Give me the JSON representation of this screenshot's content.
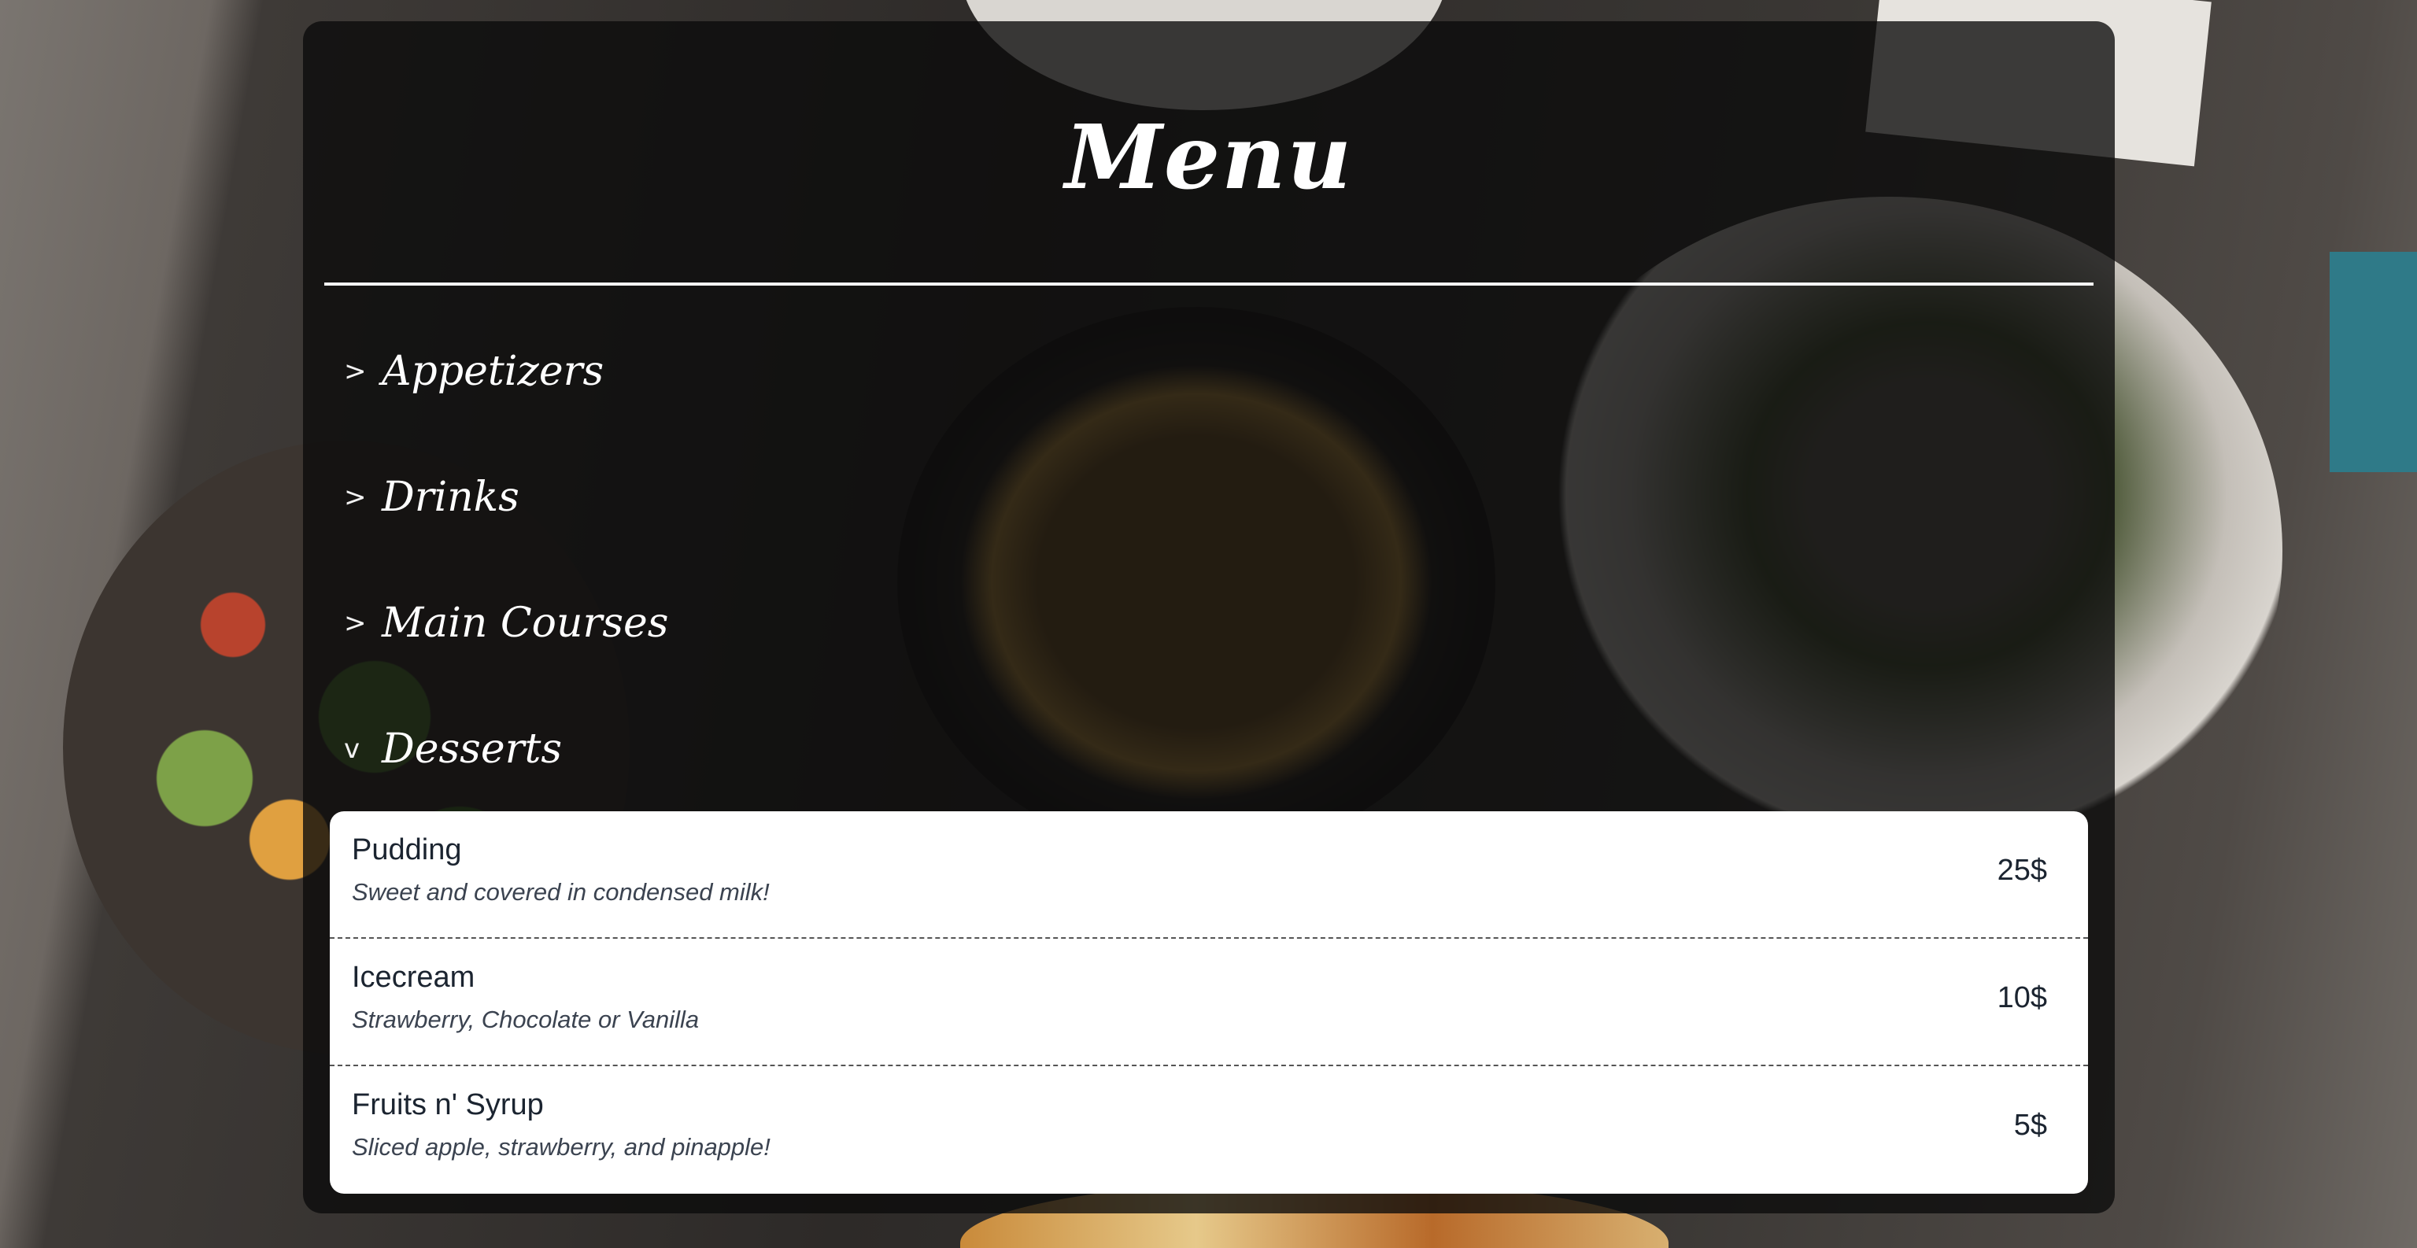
{
  "menu": {
    "title": "Menu",
    "categories": [
      {
        "label": "Appetizers",
        "chevron": ">",
        "expanded": false
      },
      {
        "label": "Drinks",
        "chevron": ">",
        "expanded": false
      },
      {
        "label": "Main Courses",
        "chevron": ">",
        "expanded": false
      },
      {
        "label": "Desserts",
        "chevron": "v",
        "expanded": true
      }
    ],
    "desserts": [
      {
        "name": "Pudding",
        "description": "Sweet and covered in condensed milk!",
        "price": "25$"
      },
      {
        "name": "Icecream",
        "description": "Strawberry, Chocolate or Vanilla",
        "price": "10$"
      },
      {
        "name": "Fruits n' Syrup",
        "description": "Sliced apple, strawberry, and pinapple!",
        "price": "5$"
      }
    ]
  },
  "colors": {
    "panel_bg": "#0a0a0a",
    "text_light": "#ffffff",
    "item_text": "#1b2430",
    "list_bg": "#ffffff"
  },
  "icons": {
    "collapsed": "chevron-right-icon",
    "expanded": "chevron-down-icon"
  }
}
